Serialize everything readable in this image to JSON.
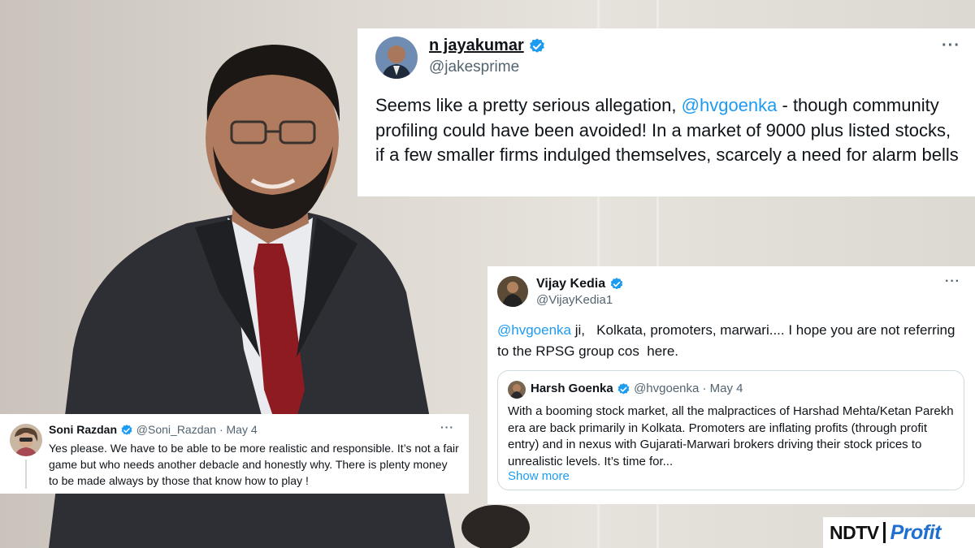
{
  "tweet_jayakumar": {
    "name": "n jayakumar",
    "handle": "@jakesprime",
    "text_before_mention": "Seems like a pretty serious allegation, ",
    "mention": "@hvgoenka",
    "text_after_mention": " - though community profiling could have been avoided! In a market of 9000 plus listed stocks, if a few smaller firms indulged themselves, scarcely a need for alarm bells",
    "more_label": "···"
  },
  "tweet_kedia": {
    "name": "Vijay Kedia",
    "handle": "@VijayKedia1",
    "mention": "@hvgoenka",
    "text_after_mention": " ji,   Kolkata, promoters, marwari.... I hope you are not referring to the RPSG group cos  here.",
    "more_label": "···",
    "quote": {
      "name": "Harsh Goenka",
      "handle_date": "@hvgoenka · May 4",
      "text": "With a booming stock market, all the malpractices of Harshad Mehta/Ketan Parekh era are back primarily in Kolkata. Promoters are inflating profits (through profit entry) and in nexus with Gujarati-Marwari brokers driving their stock prices to unrealistic levels. It’s time for...",
      "show_more": "Show more"
    }
  },
  "tweet_razdan": {
    "name": "Soni Razdan",
    "handle_date": "@Soni_Razdan · May 4",
    "text": "Yes please. We have to be able to be more realistic and responsible. It’s not a fair game but who needs another debacle and honestly why. There is plenty money to be made always by those that know how to play !",
    "more_label": "···"
  },
  "logo": {
    "ndtv": "NDTV",
    "profit": "Profit"
  },
  "colors": {
    "accent_blue": "#1d9bf0",
    "text_primary": "#0f1419",
    "text_secondary": "#536471",
    "logo_blue": "#1f6fd1"
  }
}
